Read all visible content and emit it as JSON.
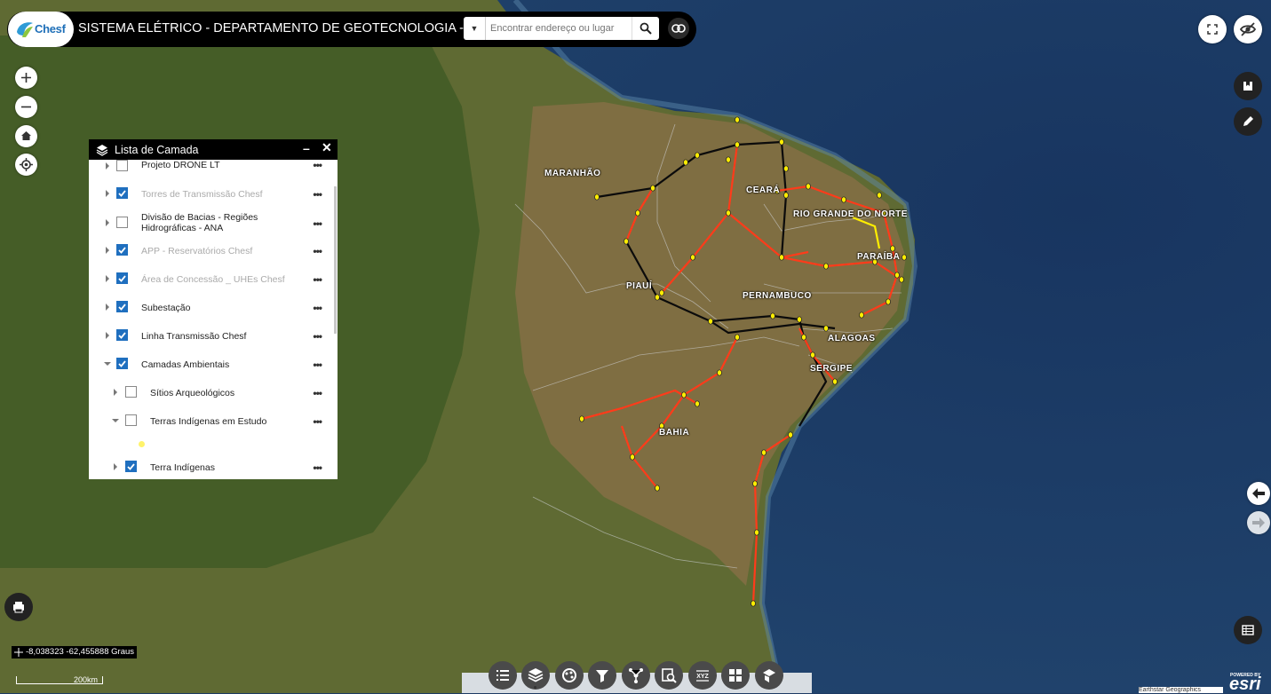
{
  "header": {
    "logo_text": "Chesf",
    "title": "SISTEMA ELÉTRICO -  DEPARTAMENTO DE GEOTECNOLOGIA - DEPG",
    "search_placeholder": "Encontrar endereço ou lugar"
  },
  "layer_panel": {
    "title": "Lista de Camada",
    "minimize_label": "–",
    "close_label": "✕",
    "more_label": "•••",
    "layers": [
      {
        "label": "Projeto DRONE LT",
        "checked": false,
        "dim": false
      },
      {
        "label": "Torres de Transmissão Chesf",
        "checked": true,
        "dim": true
      },
      {
        "label": "Divisão de Bacias - Regiões Hidrográficas - ANA",
        "checked": false,
        "dim": false
      },
      {
        "label": "APP - Reservatórios Chesf",
        "checked": true,
        "dim": true
      },
      {
        "label": "Área de Concessão _ UHEs Chesf",
        "checked": true,
        "dim": true
      },
      {
        "label": "Subestação",
        "checked": true,
        "dim": false
      },
      {
        "label": "Linha Transmissão Chesf",
        "checked": true,
        "dim": false
      },
      {
        "label": "Camadas Ambientais",
        "checked": true,
        "dim": false
      },
      {
        "label": "Sítios Arqueológicos",
        "checked": false,
        "dim": false
      },
      {
        "label": "Terras Indígenas em Estudo",
        "checked": false,
        "dim": false
      },
      {
        "label": "Terra Indígenas",
        "checked": true,
        "dim": false
      }
    ]
  },
  "map": {
    "state_labels": [
      "MARANHÃO",
      "CEARÁ",
      "RIO GRANDE DO NORTE",
      "PARAÍBA",
      "PIAUÍ",
      "PERNAMBUCO",
      "ALAGOAS",
      "SERGIPE",
      "BAHIA"
    ],
    "coordinates": "-8,038323 -62,455888 Graus",
    "scale_label": "200km",
    "attribution": "Earthstar Geographics",
    "esri_powered": "POWERED BY",
    "esri_brand": "esri"
  },
  "toolbar": {
    "icons": [
      "list-icon",
      "layers-icon",
      "legend-icon",
      "filter-icon",
      "network-icon",
      "query-icon",
      "coordinate-icon",
      "dashboard-icon",
      "basemap-icon"
    ]
  },
  "colors": {
    "ocean": "#1d3a63",
    "land": "#5f6b33",
    "line_red": "#ff3b1a",
    "line_black": "#0b0b0b",
    "tower_yellow": "#ffee00",
    "checkbox_blue": "#1f6fbf"
  }
}
